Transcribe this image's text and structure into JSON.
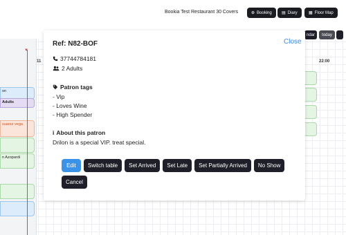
{
  "header": {
    "restaurant": "Bookia Test Restaurant 30 Covers",
    "buttons": [
      {
        "label": "Booking",
        "icon": "plus-circle-icon"
      },
      {
        "label": "Diary",
        "icon": "book-icon"
      },
      {
        "label": "Floor Map",
        "icon": "grid-icon"
      }
    ]
  },
  "timeline": {
    "subbar": {
      "calendar_label": "ndar",
      "today_label": "today"
    },
    "time_labels": [
      "0",
      "11",
      "22:00"
    ],
    "reservations": [
      {
        "text": "on",
        "color": "blue"
      },
      {
        "text": "Adults",
        "color": "purple"
      },
      {
        "text": "suarez vega",
        "color": "orange"
      },
      {
        "text": "",
        "color": "green"
      },
      {
        "text": "n Azopardi",
        "color": "green"
      },
      {
        "text": "",
        "color": "green"
      },
      {
        "text": "",
        "color": "blue"
      }
    ]
  },
  "modal": {
    "ref": "Ref: N82-BOF",
    "close_label": "Close",
    "phone": "37744784181",
    "guests": "2 Adults",
    "patron_tags_title": "Patron tags",
    "tags": [
      "- Vip",
      "- Loves Wine",
      "- High Spender"
    ],
    "about_title": "About this patron",
    "about_text": "Drilon is a special VIP. treat special.",
    "actions": {
      "edit": "Edit",
      "switch_table": "Switch table",
      "set_arrived": "Set Arrived",
      "set_late": "Set Late",
      "set_partially_arrived": "Set Partially Arrived",
      "no_show": "No Show",
      "cancel": "Cancel"
    }
  },
  "colors": {
    "primary": "#3a93e8",
    "dark_button": "#1e1f29",
    "link": "#3a8be0",
    "now_line": "#c84b4b"
  }
}
